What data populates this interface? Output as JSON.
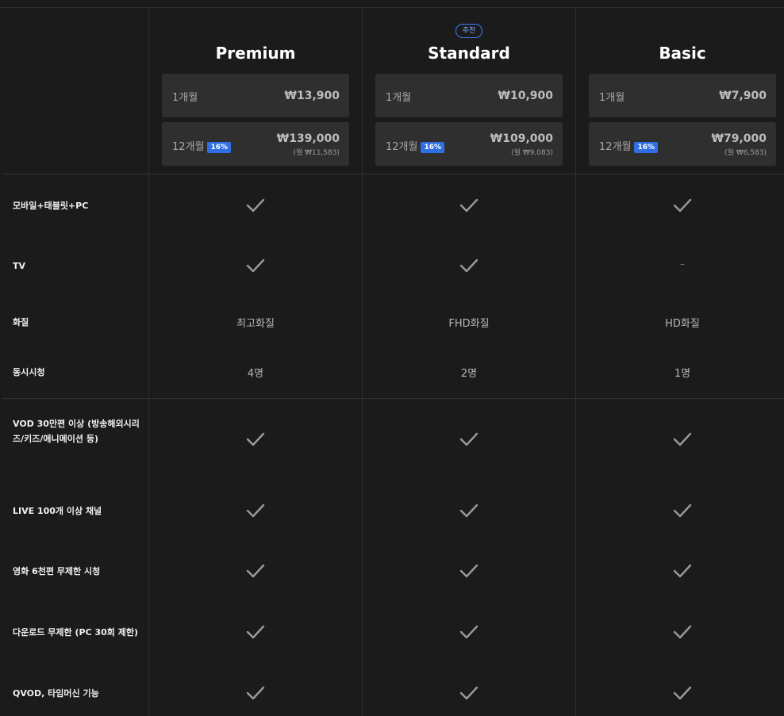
{
  "plans": [
    {
      "badge": "",
      "name": "Premium",
      "monthly": {
        "label": "1개월",
        "price": "₩13,900"
      },
      "yearly": {
        "label": "12개월",
        "discount": "16%",
        "price": "₩139,000",
        "per_month": "(월 ₩11,583)"
      }
    },
    {
      "badge": "추천",
      "name": "Standard",
      "monthly": {
        "label": "1개월",
        "price": "₩10,900"
      },
      "yearly": {
        "label": "12개월",
        "discount": "16%",
        "price": "₩109,000",
        "per_month": "(월 ₩9,083)"
      }
    },
    {
      "badge": "",
      "name": "Basic",
      "monthly": {
        "label": "1개월",
        "price": "₩7,900"
      },
      "yearly": {
        "label": "12개월",
        "discount": "16%",
        "price": "₩79,000",
        "per_month": "(월 ₩6,583)"
      }
    }
  ],
  "features": [
    {
      "label": "모바일+태블릿+PC",
      "values": [
        "check",
        "check",
        "check"
      ]
    },
    {
      "label": "TV",
      "values": [
        "check",
        "check",
        "–"
      ]
    },
    {
      "label": "화질",
      "values": [
        "최고화질",
        "FHD화질",
        "HD화질"
      ]
    },
    {
      "label": "동시시청",
      "values": [
        "4명",
        "2명",
        "1명"
      ]
    },
    {
      "label": "VOD 30만편 이상 (방송해외시리즈/키즈/애니메이션 등)",
      "values": [
        "check",
        "check",
        "check"
      ]
    },
    {
      "label": "LIVE 100개 이상 채널",
      "values": [
        "check",
        "check",
        "check"
      ]
    },
    {
      "label": "영화 6천편 무제한 시청",
      "values": [
        "check",
        "check",
        "check"
      ]
    },
    {
      "label": "다운로드 무제한 (PC 30회 제한)",
      "values": [
        "check",
        "check",
        "check"
      ]
    },
    {
      "label": "QVOD, 타임머신 기능",
      "values": [
        "check",
        "check",
        "check"
      ]
    }
  ],
  "colors": {
    "background": "#1b1b1b",
    "accent": "#2f6fe3",
    "box": "#2f2f2f"
  },
  "icons": {
    "check": "check-icon"
  }
}
